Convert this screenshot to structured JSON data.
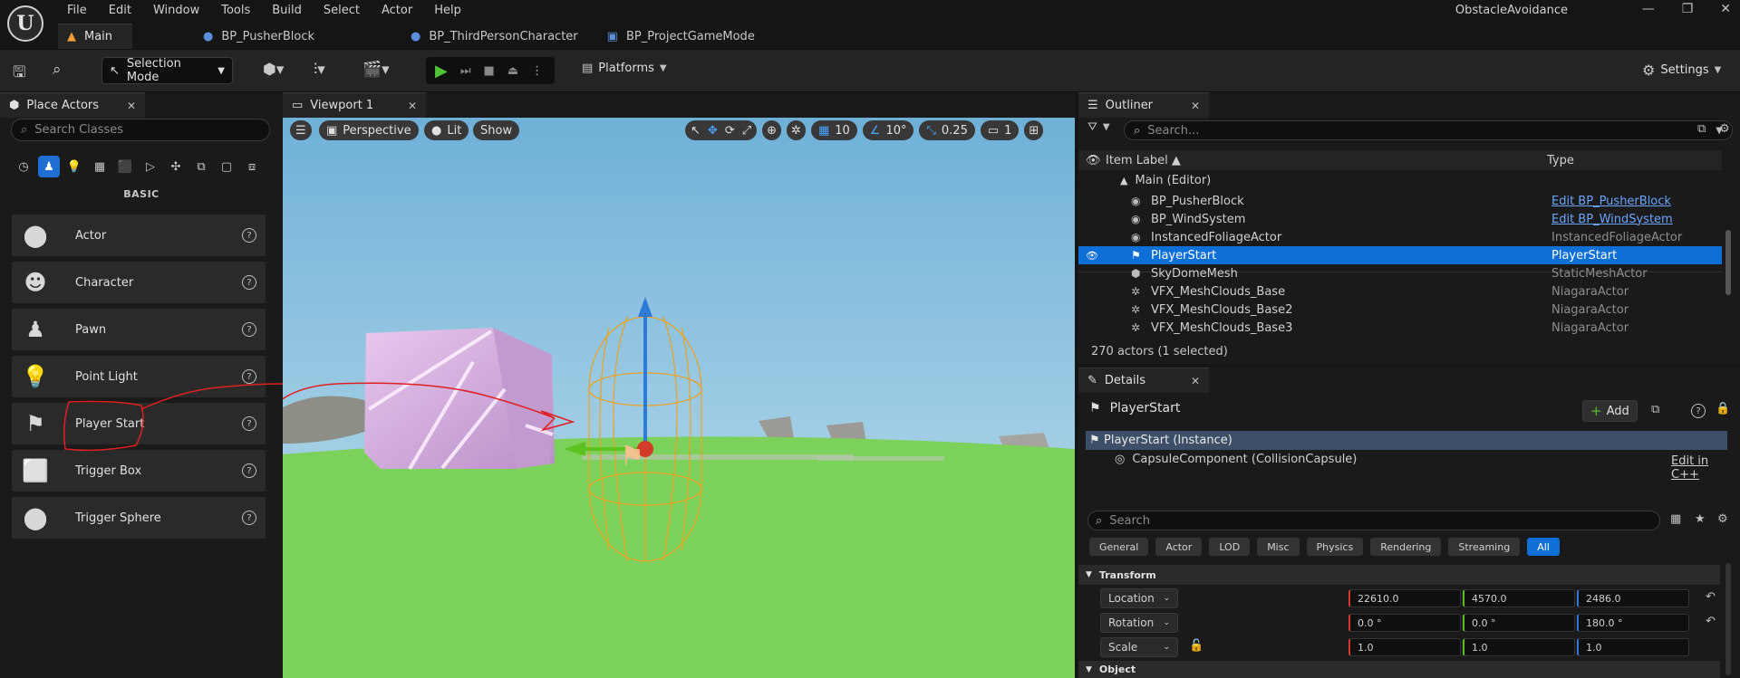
{
  "app": {
    "title": "ObstacleAvoidance",
    "logo_letter": "U",
    "menus": [
      "File",
      "Edit",
      "Window",
      "Tools",
      "Build",
      "Select",
      "Actor",
      "Help"
    ],
    "tabs": [
      {
        "label": "Main",
        "icon": "level-icon",
        "active": true
      },
      {
        "label": "BP_PusherBlock",
        "icon": "blueprint-icon",
        "active": false
      },
      {
        "label": "BP_ThirdPersonCharacter",
        "icon": "blueprint-icon",
        "active": false
      },
      {
        "label": "BP_ProjectGameMode",
        "icon": "blueprint-icon",
        "active": false
      }
    ],
    "window_buttons": [
      "—",
      "❐",
      "✕"
    ]
  },
  "toolbar": {
    "selection_mode": "Selection Mode",
    "platforms": "Platforms",
    "settings": "Settings"
  },
  "place_actors": {
    "tab_label": "Place Actors",
    "search_placeholder": "Search Classes",
    "category": "BASIC",
    "items": [
      {
        "label": "Actor",
        "icon": "sphere-icon"
      },
      {
        "label": "Character",
        "icon": "character-icon"
      },
      {
        "label": "Pawn",
        "icon": "pawn-icon"
      },
      {
        "label": "Point Light",
        "icon": "light-bulb-icon"
      },
      {
        "label": "Player Start",
        "icon": "player-start-icon"
      },
      {
        "label": "Trigger Box",
        "icon": "trigger-box-icon"
      },
      {
        "label": "Trigger Sphere",
        "icon": "trigger-sphere-icon"
      }
    ]
  },
  "viewport": {
    "tab_label": "Viewport 1",
    "perspective": "Perspective",
    "lit": "Lit",
    "show": "Show",
    "grid_snap": "10",
    "rot_snap": "10°",
    "scale_snap": "0.25",
    "camera_speed": "1"
  },
  "outliner": {
    "tab_label": "Outliner",
    "search_placeholder": "Search...",
    "col_label": "Item Label ▲",
    "col_type": "Type",
    "root": "Main (Editor)",
    "rows": [
      {
        "label": "BP_PusherBlock",
        "type": "Edit BP_PusherBlock",
        "link": true,
        "selected": false
      },
      {
        "label": "BP_WindSystem",
        "type": "Edit BP_WindSystem",
        "link": true,
        "selected": false
      },
      {
        "label": "InstancedFoliageActor",
        "type": "InstancedFoliageActor",
        "link": false,
        "selected": false
      },
      {
        "label": "PlayerStart",
        "type": "PlayerStart",
        "link": false,
        "selected": true
      },
      {
        "label": "SkyDomeMesh",
        "type": "StaticMeshActor",
        "link": false,
        "selected": false
      },
      {
        "label": "VFX_MeshClouds_Base",
        "type": "NiagaraActor",
        "link": false,
        "selected": false
      },
      {
        "label": "VFX_MeshClouds_Base2",
        "type": "NiagaraActor",
        "link": false,
        "selected": false
      },
      {
        "label": "VFX_MeshClouds_Base3",
        "type": "NiagaraActor",
        "link": false,
        "selected": false
      }
    ],
    "status": "270 actors (1 selected)"
  },
  "details": {
    "tab_label": "Details",
    "object_name": "PlayerStart",
    "add_label": "Add",
    "instance_label": "PlayerStart (Instance)",
    "component_label": "CapsuleComponent (CollisionCapsule)",
    "edit_cpp": "Edit in C++",
    "search_placeholder": "Search",
    "filters": [
      "General",
      "Actor",
      "LOD",
      "Misc",
      "Physics",
      "Rendering",
      "Streaming",
      "All"
    ],
    "active_filter": "All",
    "section_transform": "Transform",
    "section_object": "Object",
    "location": {
      "label": "Location",
      "x": "22610.0",
      "y": "4570.0",
      "z": "2486.0"
    },
    "rotation": {
      "label": "Rotation",
      "x": "0.0 °",
      "y": "0.0 °",
      "z": "180.0 °"
    },
    "scale": {
      "label": "Scale",
      "x": "1.0",
      "y": "1.0",
      "z": "1.0"
    }
  },
  "colors": {
    "accent": "#0e6fd6",
    "axis_x": "#d23a2a",
    "axis_y": "#5cc21f",
    "axis_z": "#2e7ad8",
    "annotation": "#e02020",
    "sky": "#8ec8e4",
    "grass": "#7bd15a"
  }
}
